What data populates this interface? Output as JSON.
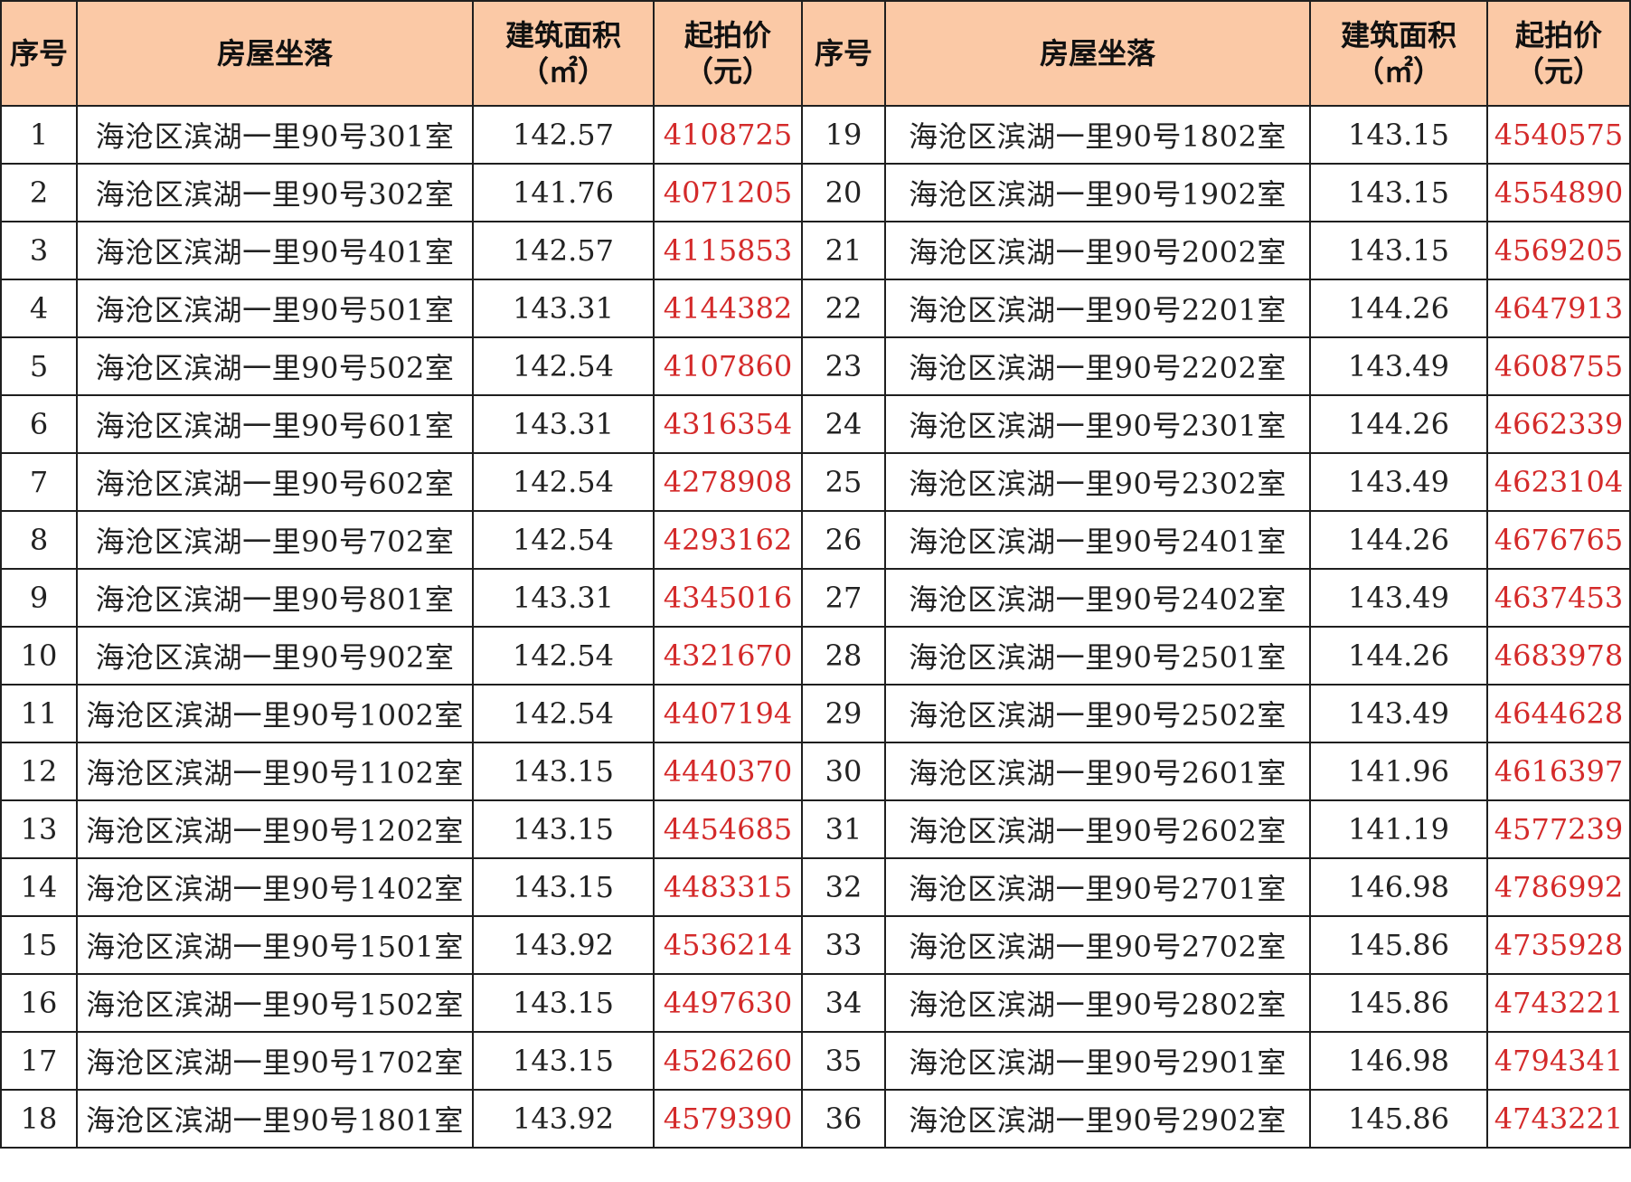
{
  "headers": {
    "seq": "序号",
    "location": "房屋坐落",
    "area_line1": "建筑面积",
    "area_line2": "（㎡）",
    "price_line1": "起拍价",
    "price_line2": "（元）"
  },
  "colors": {
    "header_bg": "#fbc9a6",
    "price_text": "#d42a2a"
  },
  "rows": [
    {
      "left": {
        "seq": "1",
        "addr": "海沧区滨湖一里90号301室",
        "area": "142.57",
        "price": "4108725"
      },
      "right": {
        "seq": "19",
        "addr": "海沧区滨湖一里90号1802室",
        "area": "143.15",
        "price": "4540575"
      }
    },
    {
      "left": {
        "seq": "2",
        "addr": "海沧区滨湖一里90号302室",
        "area": "141.76",
        "price": "4071205"
      },
      "right": {
        "seq": "20",
        "addr": "海沧区滨湖一里90号1902室",
        "area": "143.15",
        "price": "4554890"
      }
    },
    {
      "left": {
        "seq": "3",
        "addr": "海沧区滨湖一里90号401室",
        "area": "142.57",
        "price": "4115853"
      },
      "right": {
        "seq": "21",
        "addr": "海沧区滨湖一里90号2002室",
        "area": "143.15",
        "price": "4569205"
      }
    },
    {
      "left": {
        "seq": "4",
        "addr": "海沧区滨湖一里90号501室",
        "area": "143.31",
        "price": "4144382"
      },
      "right": {
        "seq": "22",
        "addr": "海沧区滨湖一里90号2201室",
        "area": "144.26",
        "price": "4647913"
      }
    },
    {
      "left": {
        "seq": "5",
        "addr": "海沧区滨湖一里90号502室",
        "area": "142.54",
        "price": "4107860"
      },
      "right": {
        "seq": "23",
        "addr": "海沧区滨湖一里90号2202室",
        "area": "143.49",
        "price": "4608755"
      }
    },
    {
      "left": {
        "seq": "6",
        "addr": "海沧区滨湖一里90号601室",
        "area": "143.31",
        "price": "4316354"
      },
      "right": {
        "seq": "24",
        "addr": "海沧区滨湖一里90号2301室",
        "area": "144.26",
        "price": "4662339"
      }
    },
    {
      "left": {
        "seq": "7",
        "addr": "海沧区滨湖一里90号602室",
        "area": "142.54",
        "price": "4278908"
      },
      "right": {
        "seq": "25",
        "addr": "海沧区滨湖一里90号2302室",
        "area": "143.49",
        "price": "4623104"
      }
    },
    {
      "left": {
        "seq": "8",
        "addr": "海沧区滨湖一里90号702室",
        "area": "142.54",
        "price": "4293162"
      },
      "right": {
        "seq": "26",
        "addr": "海沧区滨湖一里90号2401室",
        "area": "144.26",
        "price": "4676765"
      }
    },
    {
      "left": {
        "seq": "9",
        "addr": "海沧区滨湖一里90号801室",
        "area": "143.31",
        "price": "4345016"
      },
      "right": {
        "seq": "27",
        "addr": "海沧区滨湖一里90号2402室",
        "area": "143.49",
        "price": "4637453"
      }
    },
    {
      "left": {
        "seq": "10",
        "addr": "海沧区滨湖一里90号902室",
        "area": "142.54",
        "price": "4321670"
      },
      "right": {
        "seq": "28",
        "addr": "海沧区滨湖一里90号2501室",
        "area": "144.26",
        "price": "4683978"
      }
    },
    {
      "left": {
        "seq": "11",
        "addr": "海沧区滨湖一里90号1002室",
        "area": "142.54",
        "price": "4407194"
      },
      "right": {
        "seq": "29",
        "addr": "海沧区滨湖一里90号2502室",
        "area": "143.49",
        "price": "4644628"
      }
    },
    {
      "left": {
        "seq": "12",
        "addr": "海沧区滨湖一里90号1102室",
        "area": "143.15",
        "price": "4440370"
      },
      "right": {
        "seq": "30",
        "addr": "海沧区滨湖一里90号2601室",
        "area": "141.96",
        "price": "4616397"
      }
    },
    {
      "left": {
        "seq": "13",
        "addr": "海沧区滨湖一里90号1202室",
        "area": "143.15",
        "price": "4454685"
      },
      "right": {
        "seq": "31",
        "addr": "海沧区滨湖一里90号2602室",
        "area": "141.19",
        "price": "4577239"
      }
    },
    {
      "left": {
        "seq": "14",
        "addr": "海沧区滨湖一里90号1402室",
        "area": "143.15",
        "price": "4483315"
      },
      "right": {
        "seq": "32",
        "addr": "海沧区滨湖一里90号2701室",
        "area": "146.98",
        "price": "4786992"
      }
    },
    {
      "left": {
        "seq": "15",
        "addr": "海沧区滨湖一里90号1501室",
        "area": "143.92",
        "price": "4536214"
      },
      "right": {
        "seq": "33",
        "addr": "海沧区滨湖一里90号2702室",
        "area": "145.86",
        "price": "4735928"
      }
    },
    {
      "left": {
        "seq": "16",
        "addr": "海沧区滨湖一里90号1502室",
        "area": "143.15",
        "price": "4497630"
      },
      "right": {
        "seq": "34",
        "addr": "海沧区滨湖一里90号2802室",
        "area": "145.86",
        "price": "4743221"
      }
    },
    {
      "left": {
        "seq": "17",
        "addr": "海沧区滨湖一里90号1702室",
        "area": "143.15",
        "price": "4526260"
      },
      "right": {
        "seq": "35",
        "addr": "海沧区滨湖一里90号2901室",
        "area": "146.98",
        "price": "4794341"
      }
    },
    {
      "left": {
        "seq": "18",
        "addr": "海沧区滨湖一里90号1801室",
        "area": "143.92",
        "price": "4579390"
      },
      "right": {
        "seq": "36",
        "addr": "海沧区滨湖一里90号2902室",
        "area": "145.86",
        "price": "4743221"
      }
    }
  ]
}
